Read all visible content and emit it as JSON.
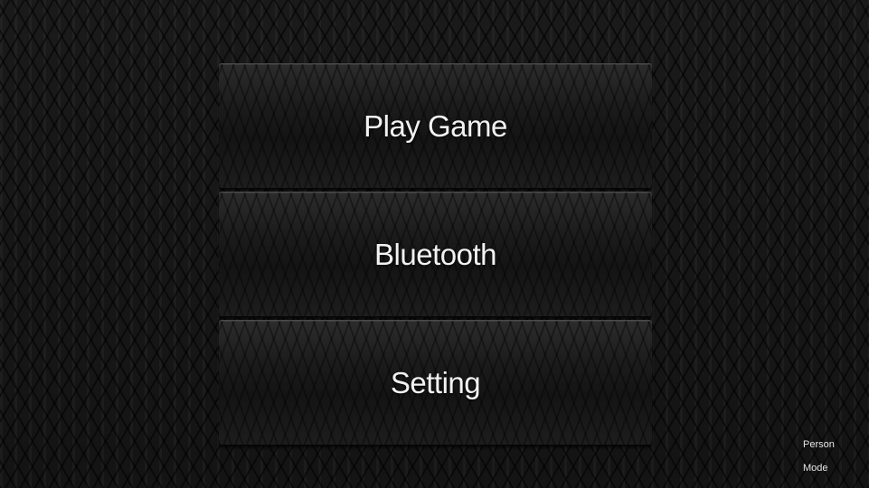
{
  "menu": {
    "play_label": "Play Game",
    "bluetooth_label": "Bluetooth",
    "setting_label": "Setting"
  },
  "mode": {
    "line1": "Person",
    "line2": "Mode"
  }
}
